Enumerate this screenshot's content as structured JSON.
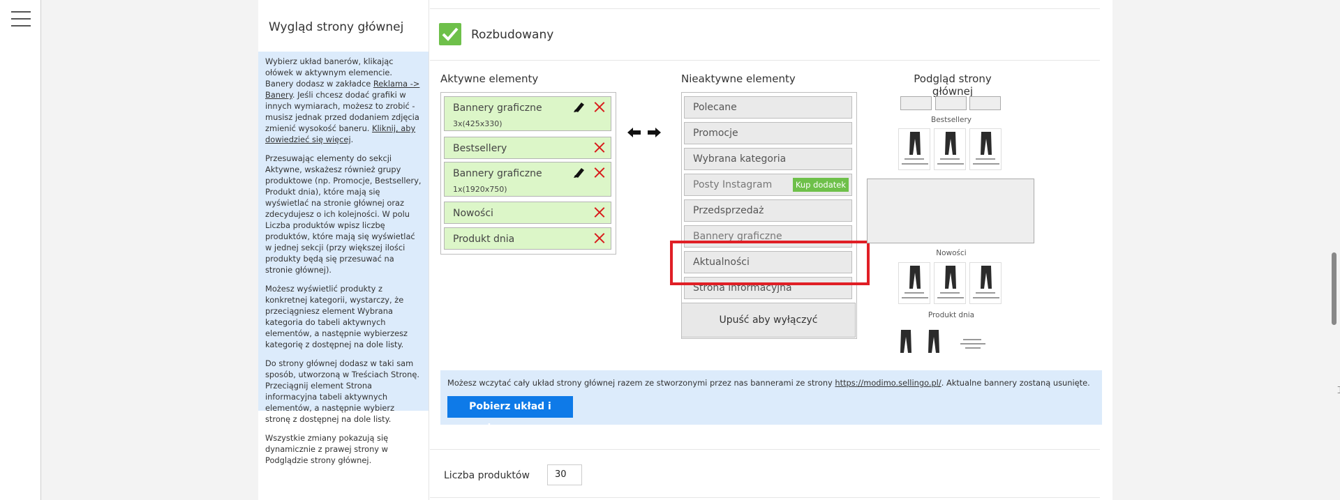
{
  "section": {
    "title": "Wygląd strony głównej"
  },
  "help": {
    "p1_a": "Wybierz układ banerów, klikając ołówek w aktywnym elemencie. Banery dodasz w zakładce ",
    "p1_link1": "Reklama -> Banery",
    "p1_b": ". Jeśli chcesz dodać grafiki w innych wymiarach, możesz to zrobić - musisz jednak przed dodaniem zdjęcia zmienić wysokość baneru. ",
    "p1_link2": "Kliknij, aby dowiedzieć się więcej",
    "p1_c": ".",
    "p2": "Przesuwając elementy do sekcji Aktywne, wskażesz również grupy produktowe (np. Promocje, Bestsellery, Produkt dnia), które mają się wyświetlać na stronie głównej oraz zdecydujesz o ich kolejności. W polu Liczba produktów wpisz liczbę produktów, które mają się wyświetlać w jednej sekcji (przy większej ilości produkty będą się przesuwać na stronie głównej).",
    "p3": "Możesz wyświetlić produkty z konkretnej kategorii, wystarczy, że przeciągniesz element Wybrana kategoria do tabeli aktywnych elementów, a następnie wybierzesz kategorię z dostępnej na dole listy.",
    "p4": "Do strony głównej dodasz w taki sam sposób, utworzoną w Treściach Stronę. Przeciągnij element Strona informacyjna tabeli aktywnych elementów, a następnie wybierz stronę z dostępnej na dole listy.",
    "p5": "Wszystkie zmiany pokazują się dynamicznie z prawej strony w Podglądzie strony głównej."
  },
  "layout_option": {
    "label": "Rozbudowany",
    "checked": true
  },
  "active": {
    "title": "Aktywne elementy",
    "items": [
      {
        "label": "Bannery graficzne",
        "sub": "3x(425x330)",
        "editable": true
      },
      {
        "label": "Bestsellery",
        "sub": "",
        "editable": false
      },
      {
        "label": "Bannery graficzne",
        "sub": "1x(1920x750)",
        "editable": true
      },
      {
        "label": "Nowości",
        "sub": "",
        "editable": false
      },
      {
        "label": "Produkt dnia",
        "sub": "",
        "editable": false
      }
    ]
  },
  "inactive": {
    "title": "Nieaktywne elementy",
    "items": [
      {
        "label": "Polecane"
      },
      {
        "label": "Promocje"
      },
      {
        "label": "Wybrana kategoria"
      },
      {
        "label": "Posty Instagram",
        "badge": "Kup dodatek"
      },
      {
        "label": "Przedsprzedaż"
      },
      {
        "label": "Bannery graficzne"
      },
      {
        "label": "Aktualności"
      },
      {
        "label": "Strona informacyjna"
      }
    ],
    "drop_label": "Upuść aby wyłączyć"
  },
  "preview": {
    "title": "Podgląd strony głównej",
    "labels": {
      "bestsellery": "Bestsellery",
      "nowosci": "Nowości",
      "produkt_dnia": "Produkt dnia"
    }
  },
  "import": {
    "text_before": "Możesz wczytać cały układ strony głównej razem ze stworzonymi przez nas bannerami ze strony ",
    "link": "https://modimo.sellingo.pl/",
    "text_after": ". Aktualne bannery zostaną usunięte.",
    "button": "Pobierz układ i bannery"
  },
  "products_count": {
    "label": "Liczba produktów",
    "value": "30"
  },
  "colors": {
    "accent_green": "#6ec04a",
    "highlight_red": "#e01f26",
    "primary_blue": "#0e7ae8",
    "info_bg": "#dcebfb"
  },
  "icons": {
    "menu": "hamburger-icon",
    "edit": "pencil-icon",
    "remove": "close-x-icon",
    "move": "bidirectional-arrow-icon"
  }
}
